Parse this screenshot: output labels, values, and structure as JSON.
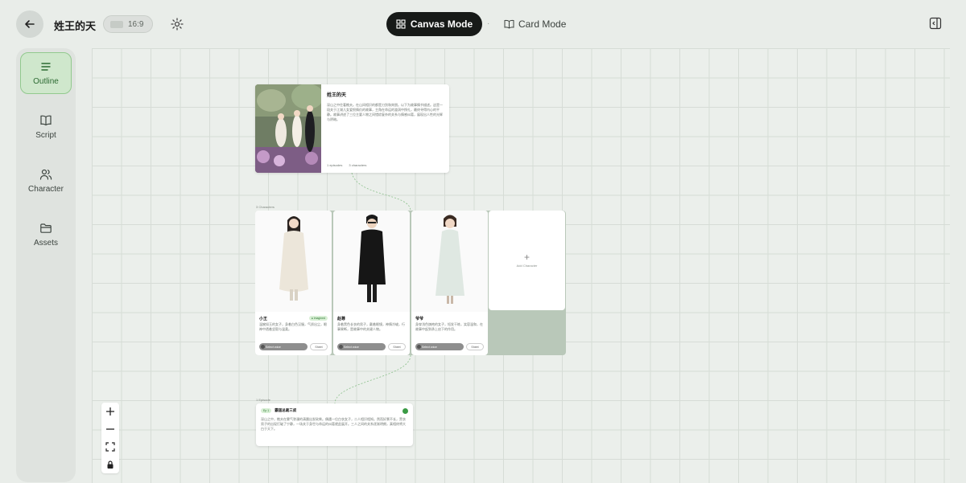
{
  "header": {
    "title": "姓王的天",
    "aspect_ratio": "16:9",
    "modes": {
      "canvas": "Canvas Mode",
      "card": "Card Mode"
    },
    "separator": "·"
  },
  "sidebar": {
    "items": [
      {
        "label": "Outline",
        "icon": "list-icon",
        "active": true
      },
      {
        "label": "Script",
        "icon": "book-icon",
        "active": false
      },
      {
        "label": "Character",
        "icon": "users-icon",
        "active": false
      },
      {
        "label": "Assets",
        "icon": "folder-icon",
        "active": false
      }
    ]
  },
  "canvas": {
    "story": {
      "title": "姓王的天",
      "text": "深山之中住著樵夫。在山间相识的都是刀剑和宾朋。以下为故事情节描述。这是一段关于江湖儿女爱恨情仇的故事，主角在命运的漩涡中挣扎，最终寻得内心的平静。故事讲述了三位主要人物之间错综复杂的关系与情感纠葛，展现出人性的光辉与阴暗。",
      "meta": [
        "1 episodes",
        "3 characters"
      ]
    },
    "characters_label": "3 Characters",
    "characters": [
      {
        "name": "小王",
        "tag": "● imagined",
        "desc": "温婉如玉的女子，身着白色汉服，气质出尘，眼神中透着坚毅与温柔。",
        "voice": "Select voice",
        "sheet": "Sheet"
      },
      {
        "name": "赵尊",
        "tag": "",
        "desc": "身着黑色长衣的男子，戴着眼镜，神情冷峻，行事果断，是故事中的关键人物。",
        "voice": "Select voice",
        "sheet": "Sheet"
      },
      {
        "name": "爷爷",
        "tag": "",
        "desc": "身穿浅色旗袍的女子，短发干练，笑容温和，在故事中起到承上启下的作用。",
        "voice": "Select voice",
        "sheet": "Sheet"
      }
    ],
    "add_character": "Add Character",
    "episodes_label": "1 Episode",
    "scene": {
      "badge": "Ep 1",
      "title": "霸道总裁三叔",
      "text": "深山之中，樵夫在雾气弥漫的清晨出发砍柴。偶遇一位白衣女子，二人相识相知。然而好景不长，黑衣男子的出现打破了宁静，一场关于身世与命运的纠葛就此展开。三人之间的关系逐渐明朗，真相终将大白于天下。"
    }
  },
  "colors": {
    "active_green": "#cfe7cc",
    "accent_dark": "#171a18",
    "status_green": "#3a9a44"
  }
}
